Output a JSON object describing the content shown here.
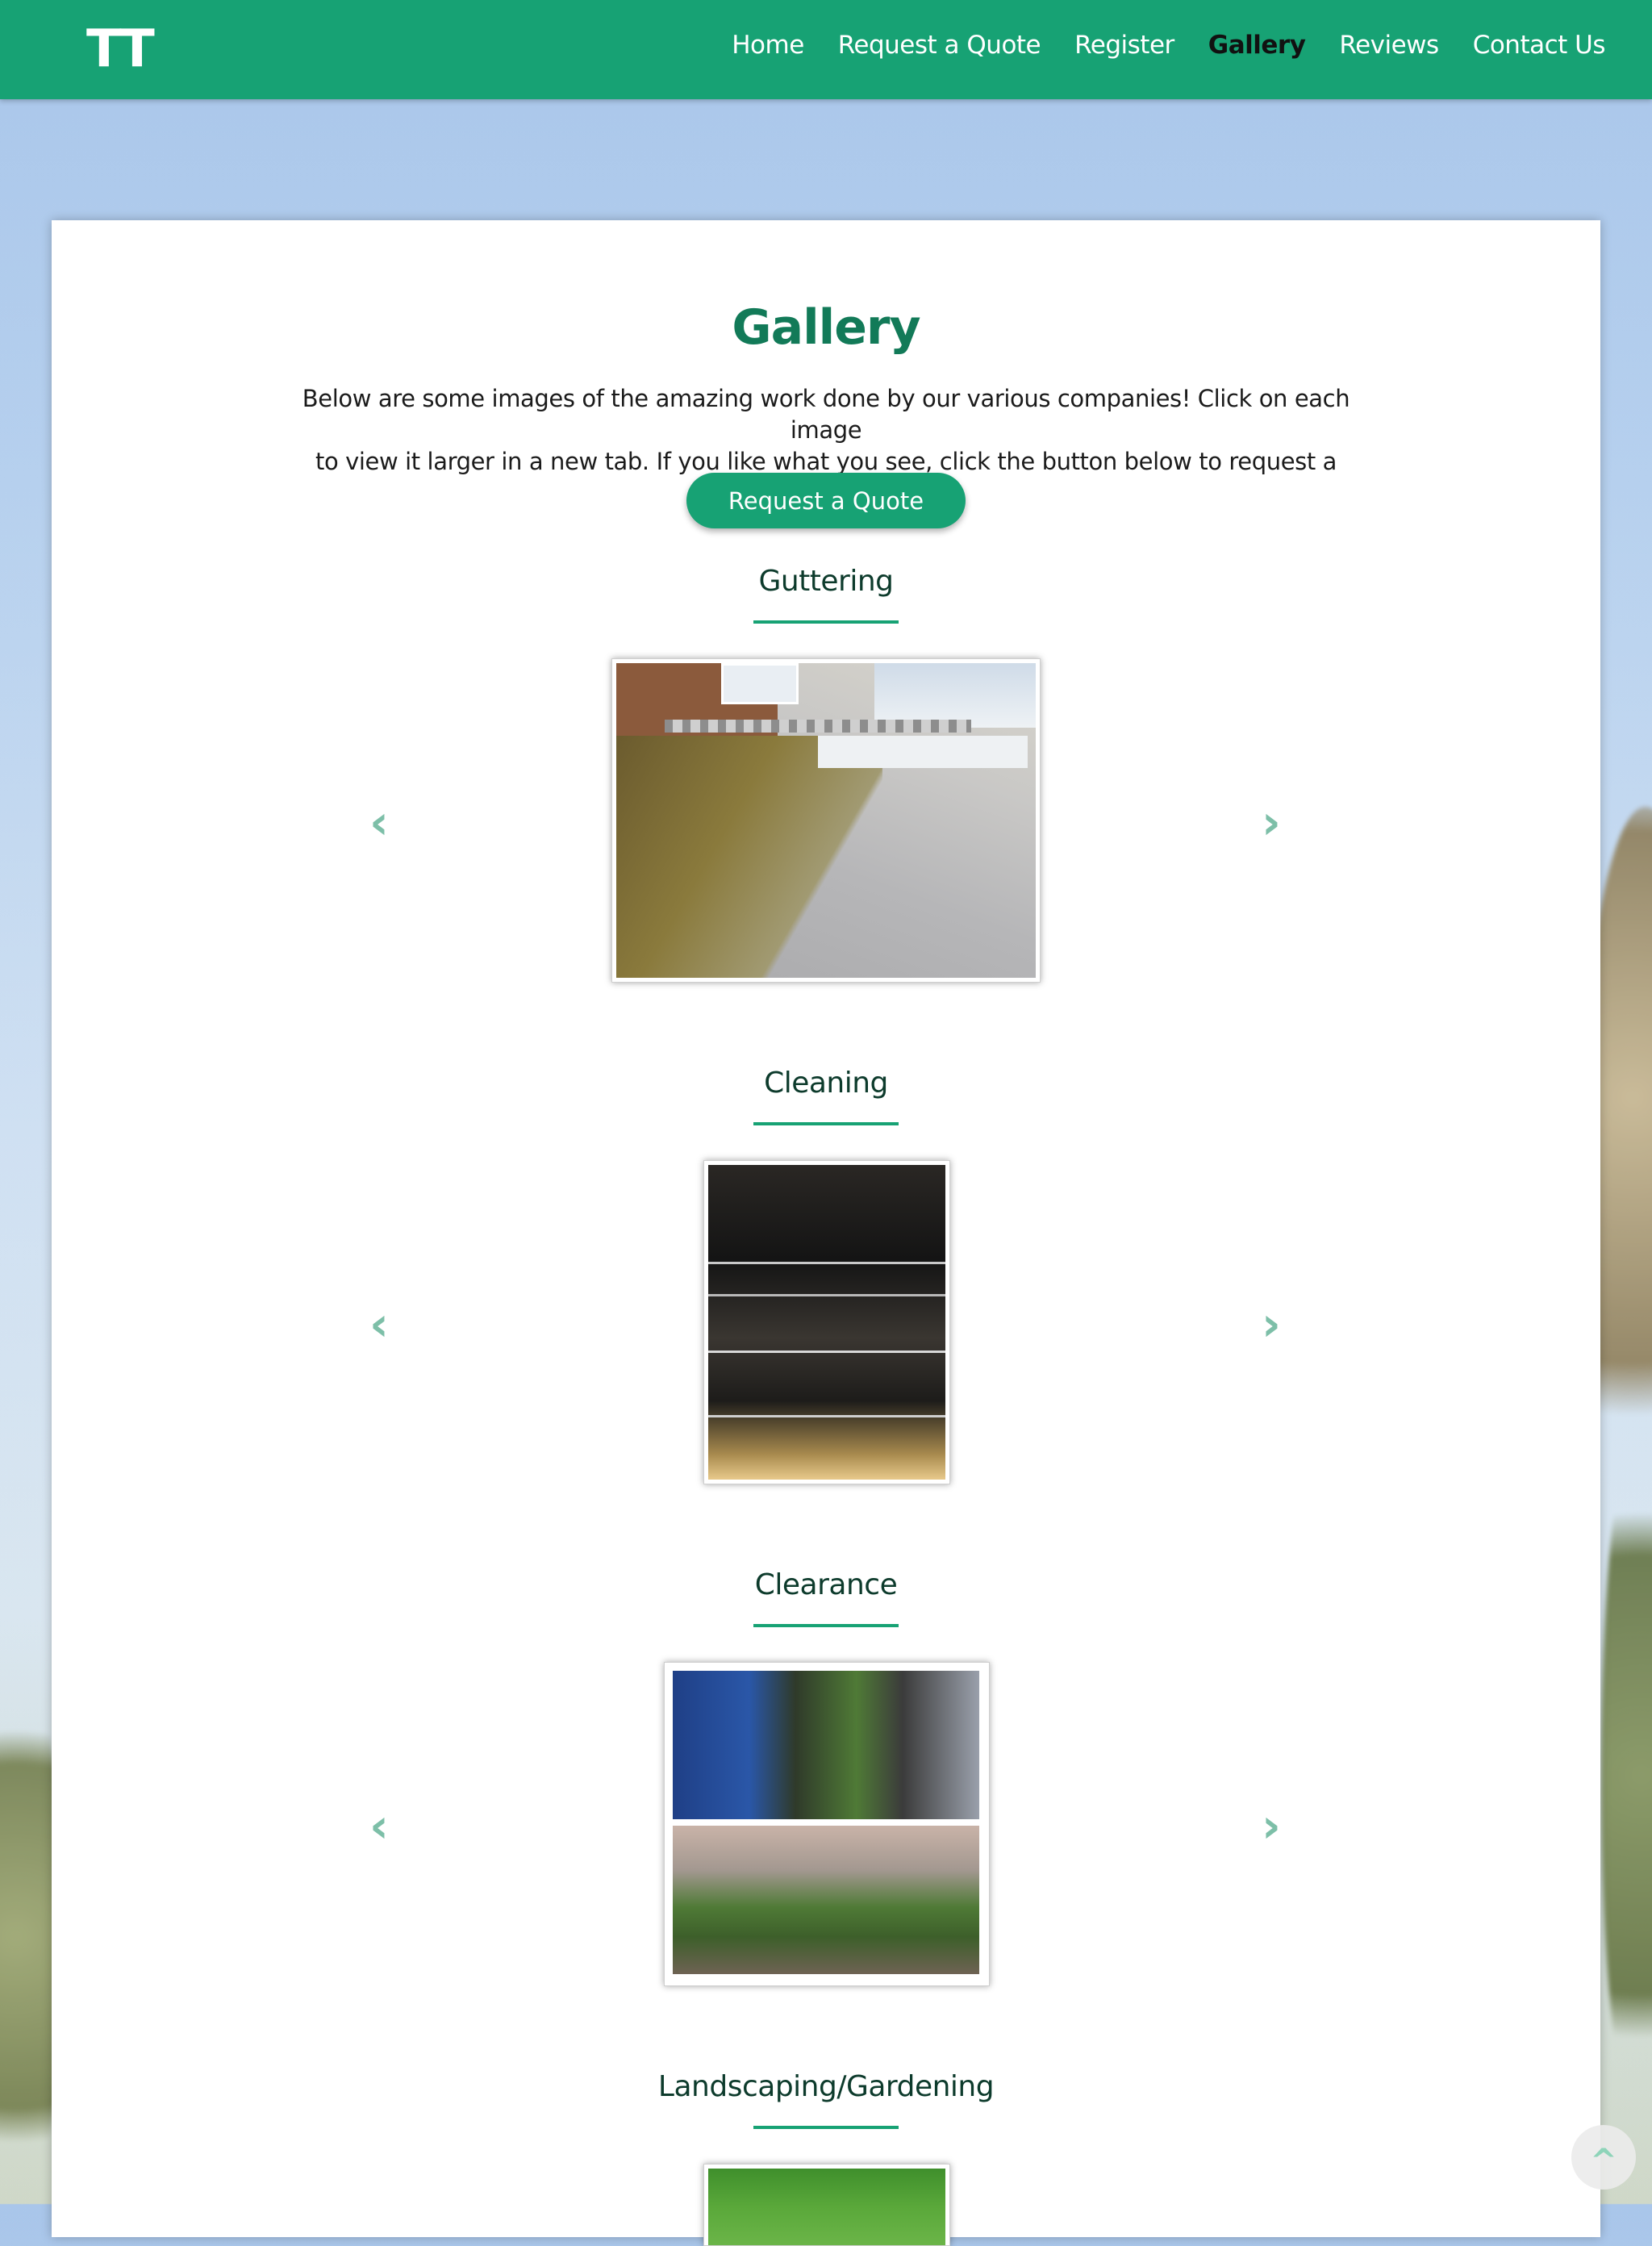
{
  "header": {
    "logo": "TT",
    "nav": [
      "Home",
      "Request a Quote",
      "Register",
      "Gallery",
      "Reviews",
      "Contact Us"
    ],
    "active": "Gallery"
  },
  "main": {
    "title": "Gallery",
    "intro_line1": "Below are some images of the amazing work done by our various companies! Click on each image",
    "intro_line2": "to view it larger in a new tab. If you like what you see, click the button below to request a quote!",
    "quote_button": "Request a Quote"
  },
  "sections": [
    {
      "heading": "Guttering"
    },
    {
      "heading": "Cleaning"
    },
    {
      "heading": "Clearance"
    },
    {
      "heading": "Landscaping/Gardening"
    }
  ],
  "icons": {
    "prev": "chevron-left-icon",
    "next": "chevron-right-icon",
    "top": "caret-up-icon"
  },
  "colors": {
    "brand": "#17a274",
    "title": "#127a58",
    "arrow": "#7dbfa8"
  },
  "back_to_top": "^"
}
